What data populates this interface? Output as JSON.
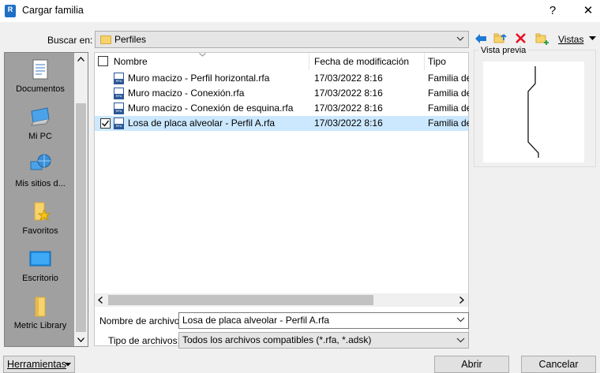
{
  "window": {
    "title": "Cargar familia",
    "app_icon_letter": "R",
    "help_label": "?",
    "close_label": "✕"
  },
  "toolbar": {
    "look_in_label": "Buscar en:",
    "look_in_value": "Perfiles",
    "views_label": "Vistas"
  },
  "places": [
    {
      "label": "Documentos",
      "icon": "documents-icon"
    },
    {
      "label": "Mi PC",
      "icon": "computer-icon"
    },
    {
      "label": "Mis sitios d...",
      "icon": "network-globe-icon"
    },
    {
      "label": "Favoritos",
      "icon": "favorites-folder-icon"
    },
    {
      "label": "Escritorio",
      "icon": "desktop-icon"
    },
    {
      "label": "Metric Library",
      "icon": "folder-icon"
    }
  ],
  "filelist": {
    "columns": {
      "name": "Nombre",
      "modified": "Fecha de modificación",
      "type": "Tipo"
    },
    "rows": [
      {
        "name": "Muro macizo - Perfil horizontal.rfa",
        "modified": "17/03/2022 8:16",
        "type": "Familia de",
        "selected": false
      },
      {
        "name": "Muro macizo - Conexión.rfa",
        "modified": "17/03/2022 8:16",
        "type": "Familia de",
        "selected": false
      },
      {
        "name": "Muro macizo - Conexión de esquina.rfa",
        "modified": "17/03/2022 8:16",
        "type": "Familia de",
        "selected": false
      },
      {
        "name": "Losa de placa alveolar - Perfil A.rfa",
        "modified": "17/03/2022 8:16",
        "type": "Familia de",
        "selected": true
      }
    ]
  },
  "preview": {
    "label": "Vista previa"
  },
  "bottom": {
    "filename_label": "Nombre de archivo:",
    "filename_value": "Losa de placa alveolar - Perfil A.rfa",
    "filetype_label": "Tipo de archivos:",
    "filetype_value": "Todos los archivos compatibles  (*.rfa, *.adsk)"
  },
  "buttons": {
    "tools": "Herramientas",
    "open": "Abrir",
    "cancel": "Cancelar"
  },
  "colors": {
    "selection": "#cce8ff",
    "accent_blue": "#1e7ad3",
    "delete_red": "#e81123",
    "folder": "#f7d36b",
    "places_bg": "#a0a0a0"
  }
}
